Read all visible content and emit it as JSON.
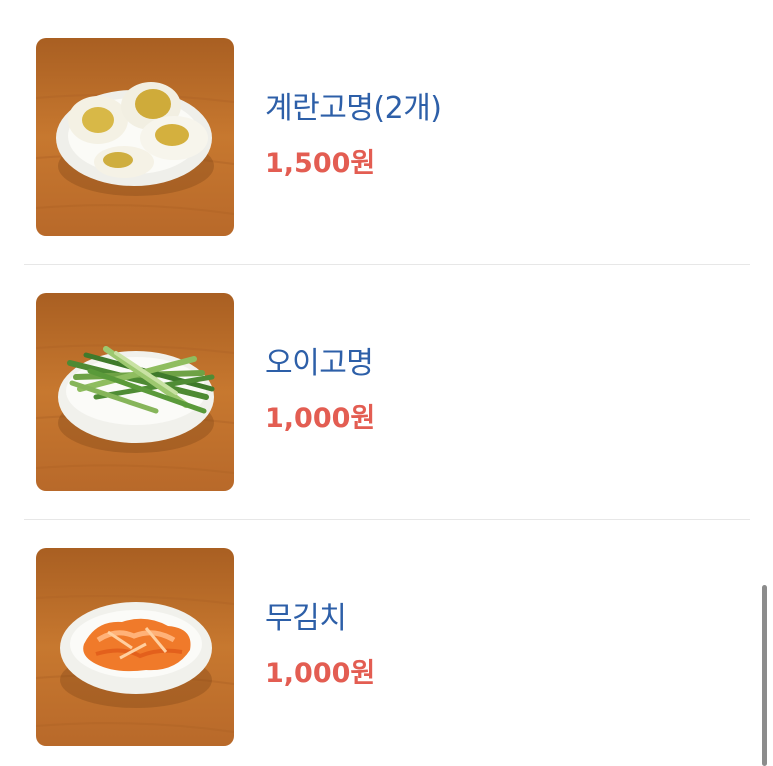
{
  "menu": {
    "items": [
      {
        "name": "계란고명(2개)",
        "price": "1,500원",
        "image_icon": "boiled-eggs-dish"
      },
      {
        "name": "오이고명",
        "price": "1,000원",
        "image_icon": "cucumber-dish"
      },
      {
        "name": "무김치",
        "price": "1,000원",
        "image_icon": "radish-kimchi-dish"
      }
    ]
  },
  "colors": {
    "name": "#2d5fa8",
    "price": "#e35d52",
    "divider": "#e7e7e7",
    "thumb_background": "#c3762e"
  }
}
